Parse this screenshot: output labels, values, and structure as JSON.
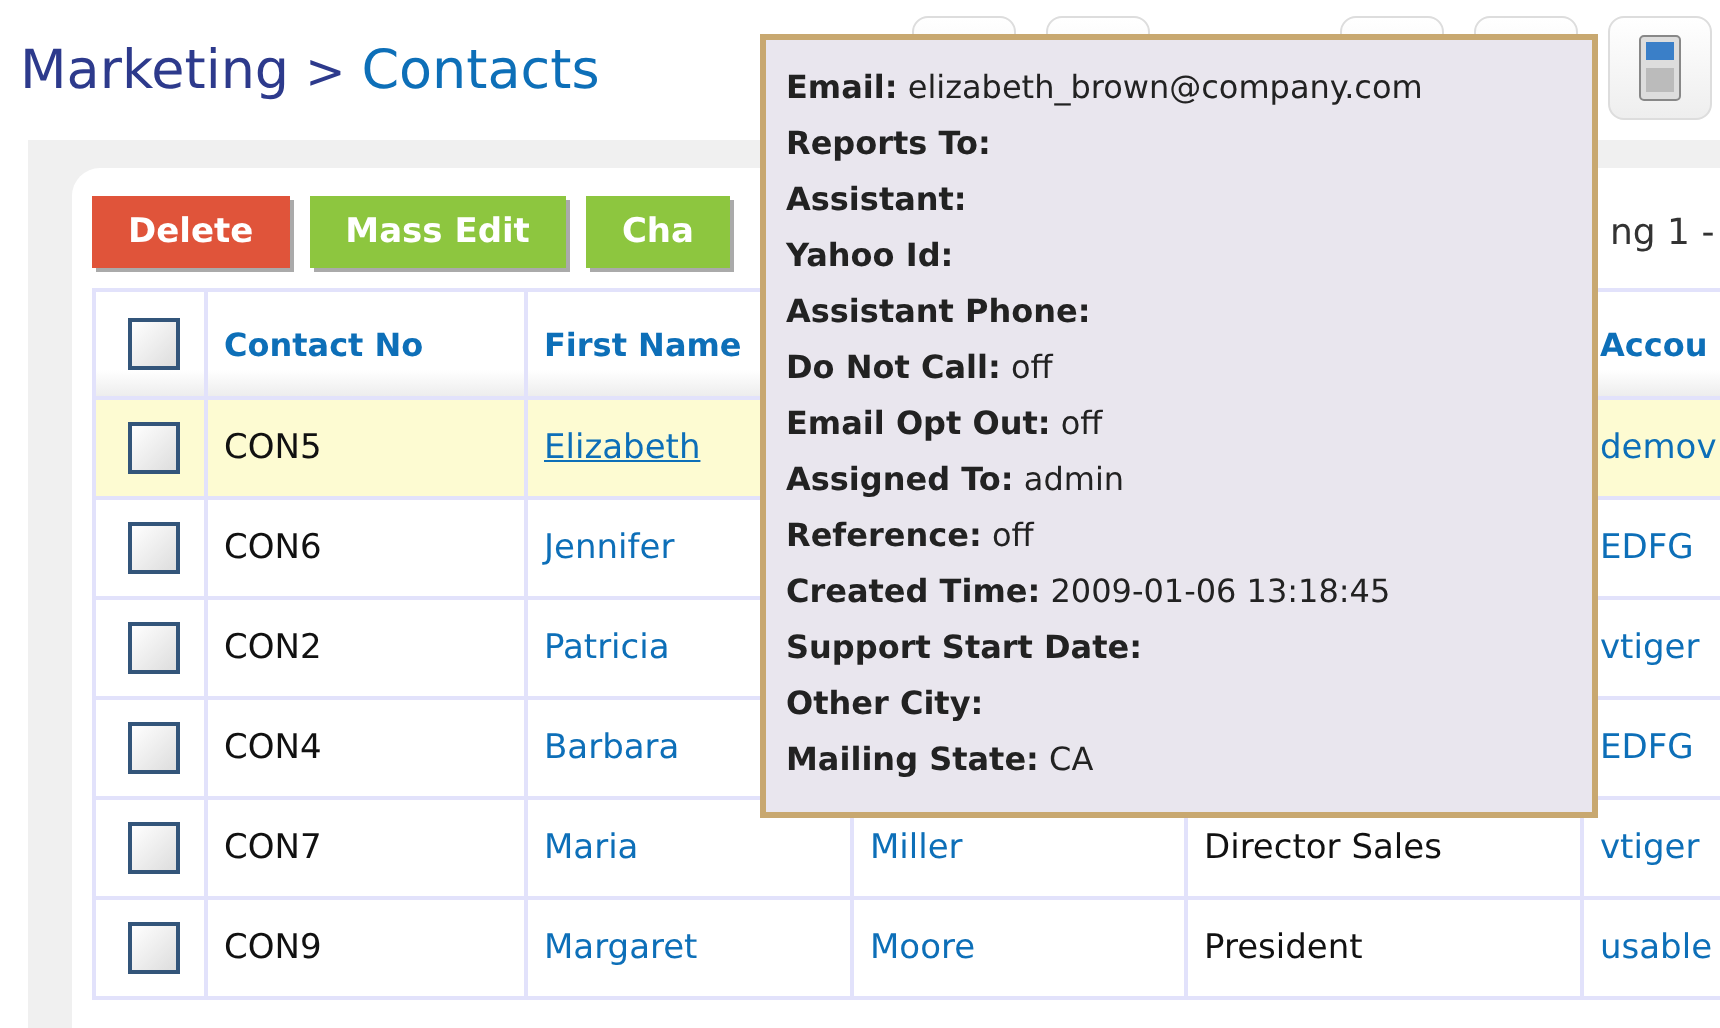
{
  "breadcrumb": {
    "module": "Marketing",
    "separator": ">",
    "page": "Contacts"
  },
  "actions": [
    {
      "label": "Delete",
      "kind": "danger"
    },
    {
      "label": "Mass Edit",
      "kind": "primary"
    },
    {
      "label": "Cha",
      "kind": "primary"
    }
  ],
  "paging": "ng 1 -",
  "table": {
    "select_all_checked": false,
    "columns": [
      "Contact No",
      "First Name",
      null,
      null,
      "Accou"
    ],
    "rows": [
      {
        "checked": false,
        "hovered": true,
        "cells": [
          "CON5",
          "Elizabeth",
          null,
          null,
          "demov"
        ]
      },
      {
        "checked": false,
        "hovered": false,
        "cells": [
          "CON6",
          "Jennifer",
          null,
          null,
          "EDFG"
        ]
      },
      {
        "checked": false,
        "hovered": false,
        "cells": [
          "CON2",
          "Patricia",
          null,
          null,
          "vtiger"
        ]
      },
      {
        "checked": false,
        "hovered": false,
        "cells": [
          "CON4",
          "Barbara",
          null,
          null,
          "EDFG"
        ]
      },
      {
        "checked": false,
        "hovered": false,
        "cells": [
          "CON7",
          "Maria",
          "Miller",
          "Director Sales",
          "vtiger"
        ]
      },
      {
        "checked": false,
        "hovered": false,
        "cells": [
          "CON9",
          "Margaret",
          "Moore",
          "President",
          "usable"
        ]
      }
    ]
  },
  "popup": {
    "fields": [
      {
        "label": "Email:",
        "value": "elizabeth_brown@company.com"
      },
      {
        "label": "Reports To:"
      },
      {
        "label": "Assistant:"
      },
      {
        "label": "Yahoo Id:"
      },
      {
        "label": "Assistant Phone:"
      },
      {
        "label": "Do Not Call:",
        "value": "off"
      },
      {
        "label": "Email Opt Out:",
        "value": "off"
      },
      {
        "label": "Assigned To:",
        "value": "admin"
      },
      {
        "label": "Reference:",
        "value": "off"
      },
      {
        "label": "Created Time:",
        "value": "2009-01-06 13:18:45"
      },
      {
        "label": "Support Start Date:"
      },
      {
        "label": "Other City:"
      },
      {
        "label": "Mailing State:",
        "value": "CA"
      }
    ]
  }
}
